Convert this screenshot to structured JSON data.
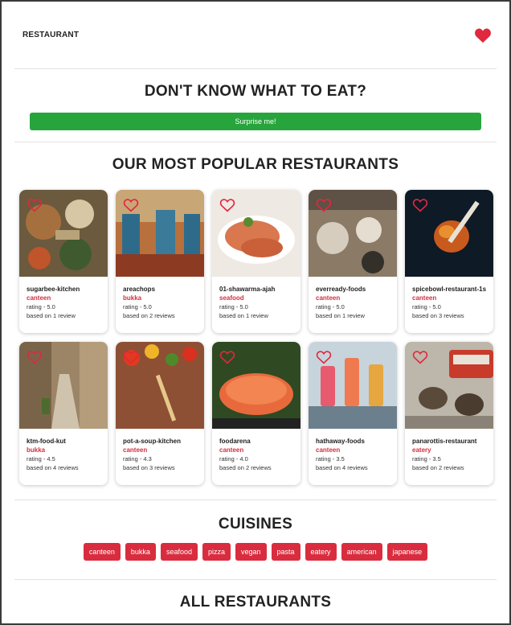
{
  "navbar": {
    "brand": "RESTAURANT"
  },
  "surprise": {
    "title": "DON'T KNOW WHAT TO EAT?",
    "button_label": "Surprise me!"
  },
  "popular": {
    "title": "OUR MOST POPULAR RESTAURANTS",
    "restaurants": [
      {
        "name": "sugarbee-kitchen",
        "category": "canteen",
        "rating": "rating - 5.0",
        "reviews": "based on 1 review"
      },
      {
        "name": "areachops",
        "category": "bukka",
        "rating": "rating - 5.0",
        "reviews": "based on 2 reviews"
      },
      {
        "name": "01-shawarma-ajah",
        "category": "seafood",
        "rating": "rating - 5.0",
        "reviews": "based on 1 review"
      },
      {
        "name": "everready-foods",
        "category": "canteen",
        "rating": "rating - 5.0",
        "reviews": "based on 1 review"
      },
      {
        "name": "spicebowl-restaurant-1s",
        "category": "canteen",
        "rating": "rating - 5.0",
        "reviews": "based on 3 reviews"
      },
      {
        "name": "ktm-food-kut",
        "category": "bukka",
        "rating": "rating - 4.5",
        "reviews": "based on 4 reviews"
      },
      {
        "name": "pot-a-soup-kitchen",
        "category": "canteen",
        "rating": "rating - 4.3",
        "reviews": "based on 3 reviews"
      },
      {
        "name": "foodarena",
        "category": "canteen",
        "rating": "rating - 4.0",
        "reviews": "based on 2 reviews"
      },
      {
        "name": "hathaway-foods",
        "category": "canteen",
        "rating": "rating - 3.5",
        "reviews": "based on 4 reviews"
      },
      {
        "name": "panarottis-restaurant",
        "category": "eatery",
        "rating": "rating - 3.5",
        "reviews": "based on 2 reviews"
      }
    ]
  },
  "cuisines": {
    "title": "CUISINES",
    "tags": [
      "canteen",
      "bukka",
      "seafood",
      "pizza",
      "vegan",
      "pasta",
      "eatery",
      "american",
      "japanese"
    ]
  },
  "all_restaurants": {
    "title": "ALL RESTAURANTS"
  },
  "colors": {
    "accent_red": "#d92d3f",
    "button_green": "#28a43d",
    "heart_red": "#e0283e"
  },
  "icons": {
    "favorite": "heart-icon"
  }
}
